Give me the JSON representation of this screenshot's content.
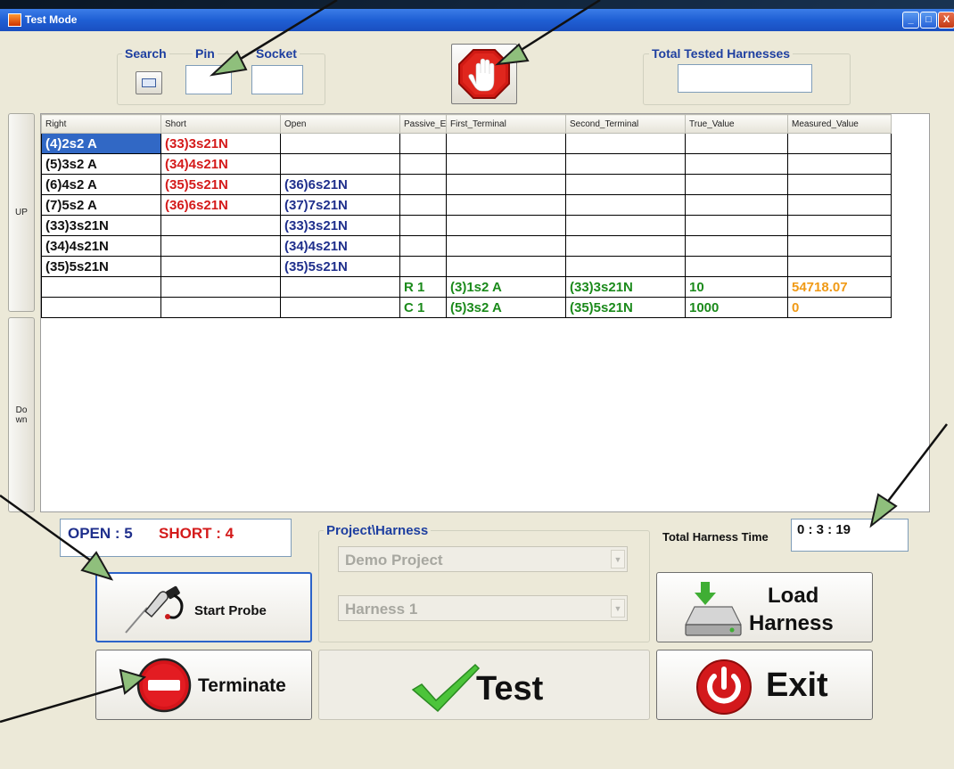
{
  "window": {
    "title": "Test Mode",
    "controls": [
      "_",
      "□",
      "X"
    ]
  },
  "search": {
    "search_label": "Search",
    "pin_label": "Pin",
    "socket_label": "Socket",
    "pin_value": "",
    "socket_value": ""
  },
  "total_tested": {
    "label": "Total Tested Harnesses",
    "value": ""
  },
  "side": {
    "up_label": "UP",
    "down_label": "Do\nwn"
  },
  "grid": {
    "columns": [
      "Right",
      "Short",
      "Open",
      "Passive_E",
      "First_Terminal",
      "Second_Terminal",
      "True_Value",
      "Measured_Value"
    ],
    "rows": [
      [
        "(4)2s2 A",
        "(33)3s21N",
        "",
        "",
        "",
        "",
        "",
        ""
      ],
      [
        "(5)3s2 A",
        "(34)4s21N",
        "",
        "",
        "",
        "",
        "",
        ""
      ],
      [
        "(6)4s2 A",
        "(35)5s21N",
        "(36)6s21N",
        "",
        "",
        "",
        "",
        ""
      ],
      [
        "(7)5s2 A",
        "(36)6s21N",
        "(37)7s21N",
        "",
        "",
        "",
        "",
        ""
      ],
      [
        "(33)3s21N",
        "",
        "(33)3s21N",
        "",
        "",
        "",
        "",
        ""
      ],
      [
        "(34)4s21N",
        "",
        "(34)4s21N",
        "",
        "",
        "",
        "",
        ""
      ],
      [
        "(35)5s21N",
        "",
        "(35)5s21N",
        "",
        "",
        "",
        "",
        ""
      ],
      [
        "",
        "",
        "",
        "R 1",
        "(3)1s2 A",
        "(33)3s21N",
        "10",
        "54718.07"
      ],
      [
        "",
        "",
        "",
        "C 1",
        "(5)3s2 A",
        "(35)5s21N",
        "1000",
        "0"
      ]
    ]
  },
  "status": {
    "open": "OPEN : 5",
    "short": "SHORT : 4"
  },
  "project": {
    "label": "Project\\Harness",
    "project_value": "Demo Project",
    "harness_value": "Harness 1"
  },
  "time": {
    "label": "Total Harness Time",
    "value": "0 : 3 : 19"
  },
  "buttons": {
    "start_probe": "Start Probe",
    "terminate": "Terminate",
    "test": "Test",
    "load_harness_1": "Load",
    "load_harness_2": "Harness",
    "exit": "Exit"
  },
  "colors": {
    "selection": "#3168c5",
    "short_red": "#d41a1a",
    "open_blue": "#1f2f8c",
    "passive_green": "#1b8a1b",
    "measured_orange": "#f09a16"
  },
  "icons": [
    "window-app-icon",
    "keyboard-icon",
    "stop-hand-icon",
    "probe-icon",
    "terminate-icon",
    "check-icon",
    "load-drive-icon",
    "power-icon"
  ]
}
